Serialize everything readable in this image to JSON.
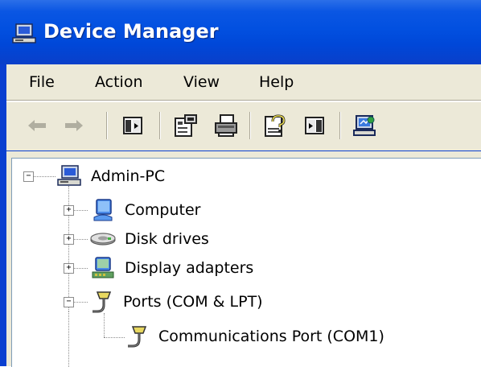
{
  "window": {
    "title": "Device Manager",
    "title_icon": "device-manager-icon",
    "colors": {
      "titlebar": "#0250e0",
      "chrome": "#ece9d8",
      "tree_bg": "#ffffff"
    }
  },
  "menubar": {
    "items": [
      {
        "label": "File"
      },
      {
        "label": "Action"
      },
      {
        "label": "View"
      },
      {
        "label": "Help"
      }
    ]
  },
  "toolbar": {
    "buttons": [
      {
        "icon": "back-arrow-icon",
        "enabled": false
      },
      {
        "icon": "forward-arrow-icon",
        "enabled": false
      },
      {
        "icon": "show-hide-console-tree-icon",
        "enabled": true
      },
      {
        "icon": "properties-icon",
        "enabled": true
      },
      {
        "icon": "print-icon",
        "enabled": true
      },
      {
        "icon": "help-icon",
        "enabled": true
      },
      {
        "icon": "show-hide-action-pane-icon",
        "enabled": true
      },
      {
        "icon": "scan-hardware-changes-icon",
        "enabled": true
      }
    ]
  },
  "tree": {
    "root": {
      "label": "Admin-PC",
      "icon": "computer-icon",
      "expanded": true
    },
    "items": [
      {
        "label": "Computer",
        "icon": "computer-monitor-icon",
        "expanded": false
      },
      {
        "label": "Disk drives",
        "icon": "disk-drive-icon",
        "expanded": false
      },
      {
        "label": "Display adapters",
        "icon": "display-adapter-icon",
        "expanded": false
      },
      {
        "label": "Ports (COM & LPT)",
        "icon": "port-connector-icon",
        "expanded": true,
        "children": [
          {
            "label": "Communications Port (COM1)",
            "icon": "port-connector-icon"
          }
        ]
      }
    ]
  }
}
